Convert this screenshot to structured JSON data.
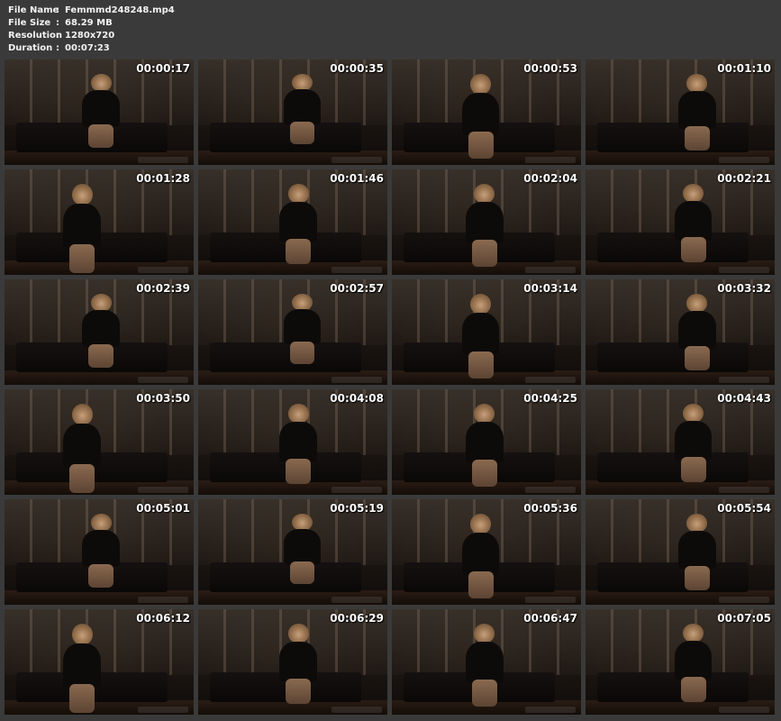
{
  "info": [
    {
      "label": "File Name",
      "sep": ":",
      "value": "Femmmd248248.mp4"
    },
    {
      "label": "File Size",
      "sep": ":",
      "value": "68.29 MB"
    },
    {
      "label": "Resolution",
      "sep": ":",
      "value": "1280x720"
    },
    {
      "label": "Duration",
      "sep": ":",
      "value": "00:07:23"
    }
  ],
  "thumbnails": [
    "00:00:17",
    "00:00:35",
    "00:00:53",
    "00:01:10",
    "00:01:28",
    "00:01:46",
    "00:02:04",
    "00:02:21",
    "00:02:39",
    "00:02:57",
    "00:03:14",
    "00:03:32",
    "00:03:50",
    "00:04:08",
    "00:04:25",
    "00:04:43",
    "00:05:01",
    "00:05:19",
    "00:05:36",
    "00:05:54",
    "00:06:12",
    "00:06:29",
    "00:06:47",
    "00:07:05"
  ],
  "colors": {
    "background": "#3a3a3a",
    "text": "#f2f2f2"
  }
}
